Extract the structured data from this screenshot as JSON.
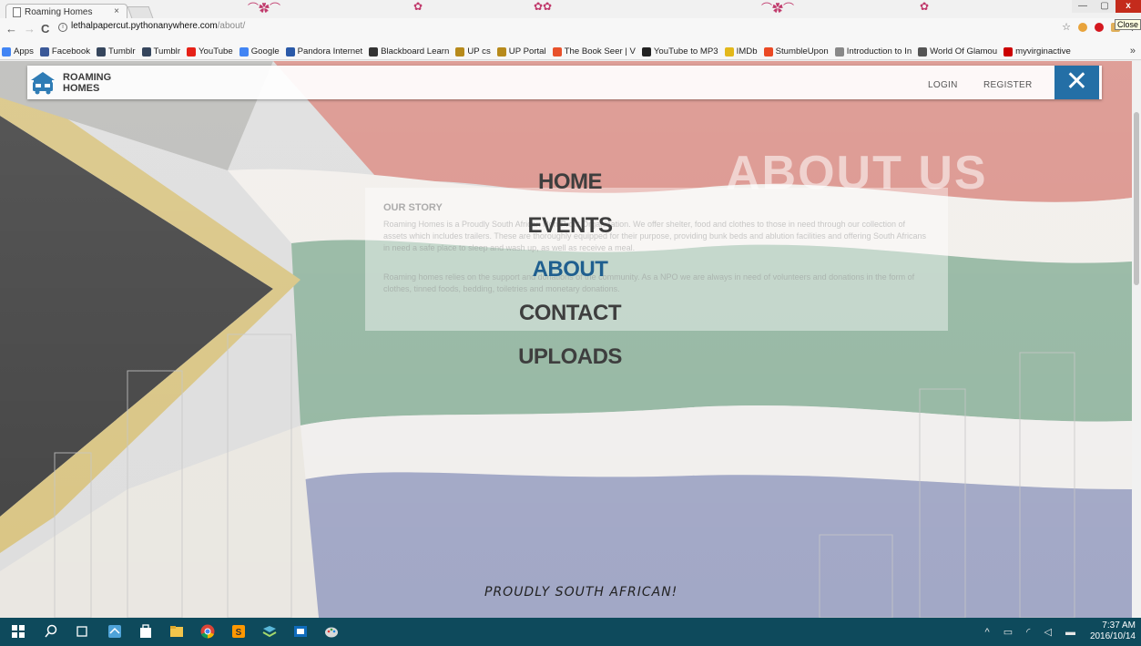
{
  "browser": {
    "tab_title": "Roaming Homes",
    "tab_close": "×",
    "tooltip": "Close",
    "window_min": "—",
    "window_max": "▢",
    "window_close": "x",
    "url_host": "lethalpapercut.pythonanywhere.com",
    "url_path": "/about/",
    "bookmarks": [
      {
        "label": "Apps",
        "color": "#4285f4"
      },
      {
        "label": "Facebook",
        "color": "#3b5998"
      },
      {
        "label": "Tumblr",
        "color": "#36465d"
      },
      {
        "label": "Tumblr",
        "color": "#36465d"
      },
      {
        "label": "YouTube",
        "color": "#e62117"
      },
      {
        "label": "Google",
        "color": "#4285f4"
      },
      {
        "label": "Pandora Internet",
        "color": "#2a59a8"
      },
      {
        "label": "Blackboard Learn",
        "color": "#333333"
      },
      {
        "label": "UP cs",
        "color": "#b78a1b"
      },
      {
        "label": "UP Portal",
        "color": "#b78a1b"
      },
      {
        "label": "The Book Seer | V",
        "color": "#e8512b"
      },
      {
        "label": "YouTube to MP3",
        "color": "#222222"
      },
      {
        "label": "IMDb",
        "color": "#e3b81b"
      },
      {
        "label": "StumbleUpon",
        "color": "#eb4924"
      },
      {
        "label": "Introduction to In",
        "color": "#888888"
      },
      {
        "label": "World Of Glamou",
        "color": "#555555"
      },
      {
        "label": "myvirginactive",
        "color": "#cc0000"
      }
    ],
    "bookmarks_more": "»"
  },
  "header": {
    "logo_line1": "ROAMING",
    "logo_line2": "HOMES",
    "login": "LOGIN",
    "register": "REGISTER",
    "close_glyph": "✕"
  },
  "about": {
    "title": "ABOUT US",
    "story_heading": "OUR STORY",
    "para1": "Roaming Homes is a Proudly South African Non-Profit Organization. We offer shelter, food and clothes to those in need through our collection of assets which includes trailers. These are thoroughly equipped for their purpose, providing bunk beds and ablution facilities and offering South Africans in need a safe place to sleep and wash up, as well as receive a meal.",
    "para2": "Roaming homes relies on the support and donations of the community. As a NPO we are always in need of volunteers and donations in the form of clothes, tinned foods, bedding, toiletries and monetary donations."
  },
  "menu": {
    "items": [
      "HOME",
      "EVENTS",
      "ABOUT",
      "CONTACT",
      "UPLOADS"
    ],
    "active": "ABOUT"
  },
  "footer": {
    "tagline": "PROUDLY SOUTH AFRICAN!"
  },
  "taskbar": {
    "time": "7:37 AM",
    "date": "2016/10/14",
    "tray_glyphs": "^ ▭ ◜ ◁ ▬"
  },
  "colors": {
    "accent_blue": "#246fa6",
    "menu_active": "#1f5f8f",
    "taskbar": "#0e4a5c"
  }
}
